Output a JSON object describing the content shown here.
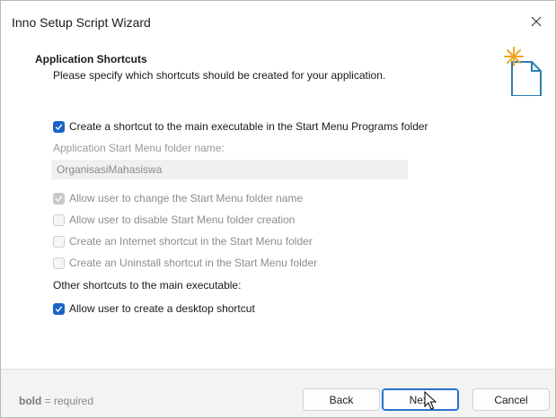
{
  "window": {
    "title": "Inno Setup Script Wizard"
  },
  "header": {
    "title": "Application Shortcuts",
    "subtitle": "Please specify which shortcuts should be created for your application."
  },
  "options": {
    "main_shortcut": {
      "label": "Create a shortcut to the main executable in the Start Menu Programs folder",
      "checked": true
    },
    "folder_name_label": "Application Start Menu folder name:",
    "folder_name_value": "OrganisasiMahasiswa",
    "allow_change_folder": {
      "label": "Allow user to change the Start Menu folder name",
      "checked": true,
      "disabled": true
    },
    "allow_disable_folder": {
      "label": "Allow user to disable Start Menu folder creation",
      "checked": false,
      "disabled": true
    },
    "internet_shortcut": {
      "label": "Create an Internet shortcut in the Start Menu folder",
      "checked": false,
      "disabled": true
    },
    "uninstall_shortcut": {
      "label": "Create an Uninstall shortcut in the Start Menu folder",
      "checked": false,
      "disabled": true
    },
    "other_label": "Other shortcuts to the main executable:",
    "desktop_shortcut": {
      "label": "Allow user to create a desktop shortcut",
      "checked": true
    }
  },
  "footer": {
    "legend_bold": "bold",
    "legend_rest": " = required",
    "back_label": "Back",
    "next_label": "Next",
    "cancel_label": "Cancel"
  },
  "colors": {
    "accent": "#1a63c6",
    "footer_bg": "#f3f3f3"
  },
  "icons": {
    "close": "close-icon",
    "header": "new-document-icon",
    "cursor": "mouse-pointer-icon"
  }
}
